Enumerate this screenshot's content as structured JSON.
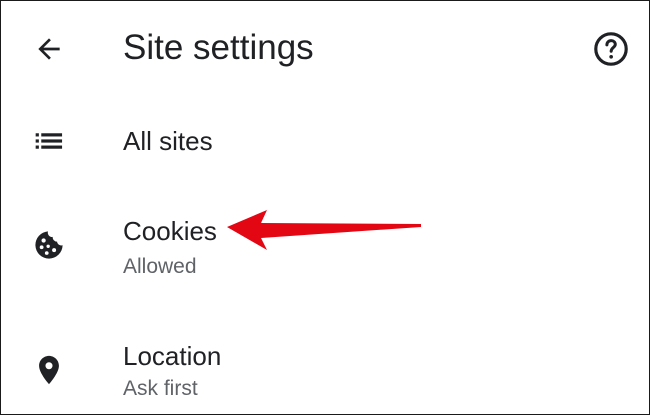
{
  "header": {
    "title": "Site settings",
    "back_icon": "arrow-back-icon",
    "help_icon": "help-circle-icon"
  },
  "items": [
    {
      "label": "All sites",
      "subtitle": "",
      "icon": "list-icon"
    },
    {
      "label": "Cookies",
      "subtitle": "Allowed",
      "icon": "cookie-icon"
    },
    {
      "label": "Location",
      "subtitle": "Ask first",
      "icon": "location-pin-icon"
    }
  ],
  "colors": {
    "text_primary": "#202124",
    "text_secondary": "#5f6368",
    "annotation_arrow": "#e30613"
  }
}
